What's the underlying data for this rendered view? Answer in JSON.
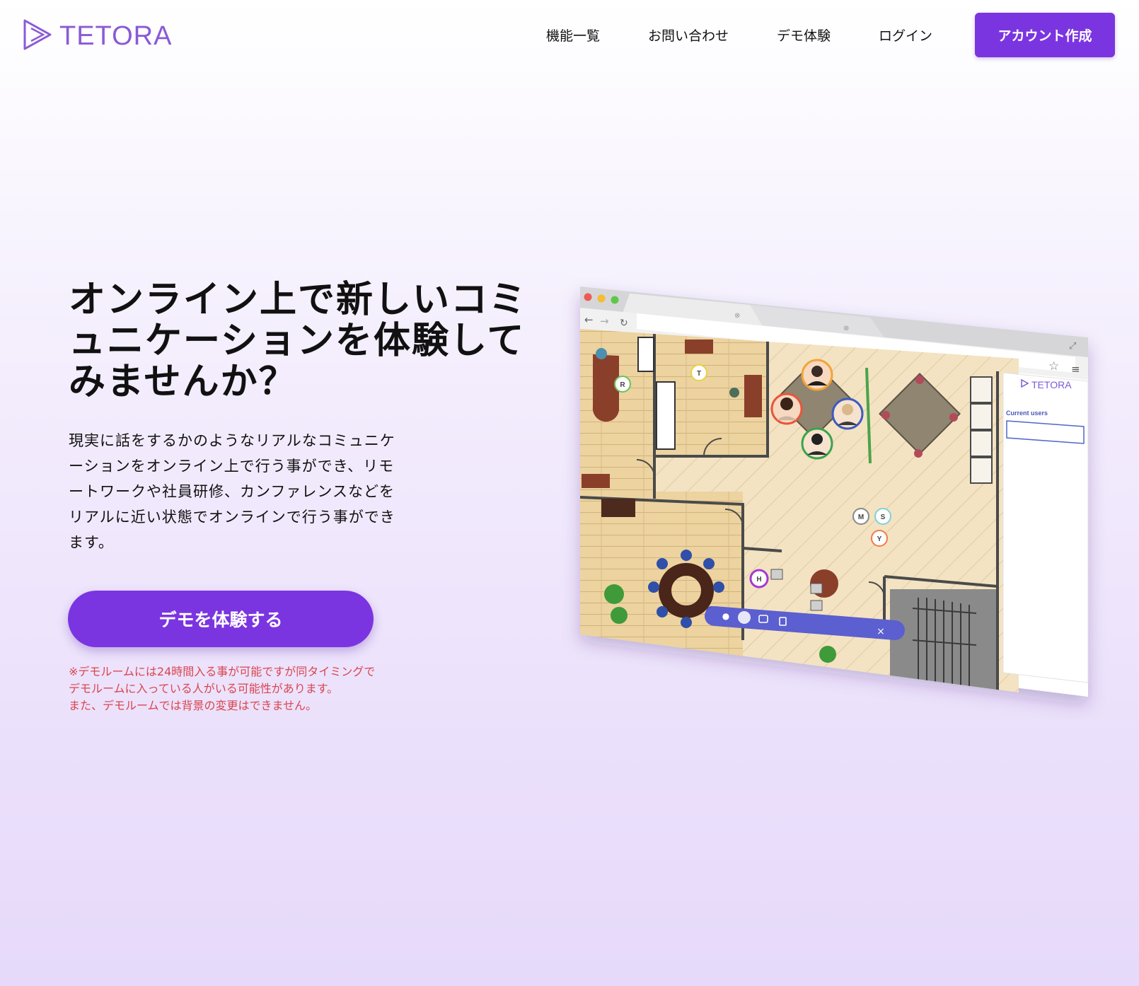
{
  "header": {
    "logo_text": "TETORA",
    "nav": [
      "機能一覧",
      "お問い合わせ",
      "デモ体験",
      "ログイン"
    ],
    "cta_label": "アカウント作成"
  },
  "hero": {
    "title_lines": [
      "オンライン上で新しいコミ",
      "ュニケーションを体験して",
      "みませんか？"
    ],
    "description_lines": [
      "現実に話をするかのようなリアルなコミュニケ",
      "ーションをオンライン上で行う事ができ、リモ",
      "ートワークや社員研修、カンファレンスなどを",
      "リアルに近い状態でオンラインで行う事ができ",
      "ます。"
    ],
    "demo_button_label": "デモを体験する",
    "notes": [
      "※デモルームには24時間入る事が可能ですが同タイミングで",
      "デモルームに入っている人がいる可能性があります。",
      "また、デモルームでは背景の変更はできません。"
    ]
  },
  "mockup": {
    "panel_logo_text": "TETORA",
    "panel_label": "Current users",
    "user_markers": [
      "R",
      "T",
      "M",
      "S",
      "Y",
      "H"
    ],
    "toolbar_icons": [
      "microphone-icon",
      "camera-icon",
      "screen-share-icon",
      "file-icon",
      "close-icon"
    ],
    "toolbar_close_glyph": "×",
    "colors": {
      "accent": "#7b35e0",
      "toolbar": "#5b5fcf",
      "floor": "#f2dfb8",
      "wall": "#4a4a4a"
    }
  }
}
